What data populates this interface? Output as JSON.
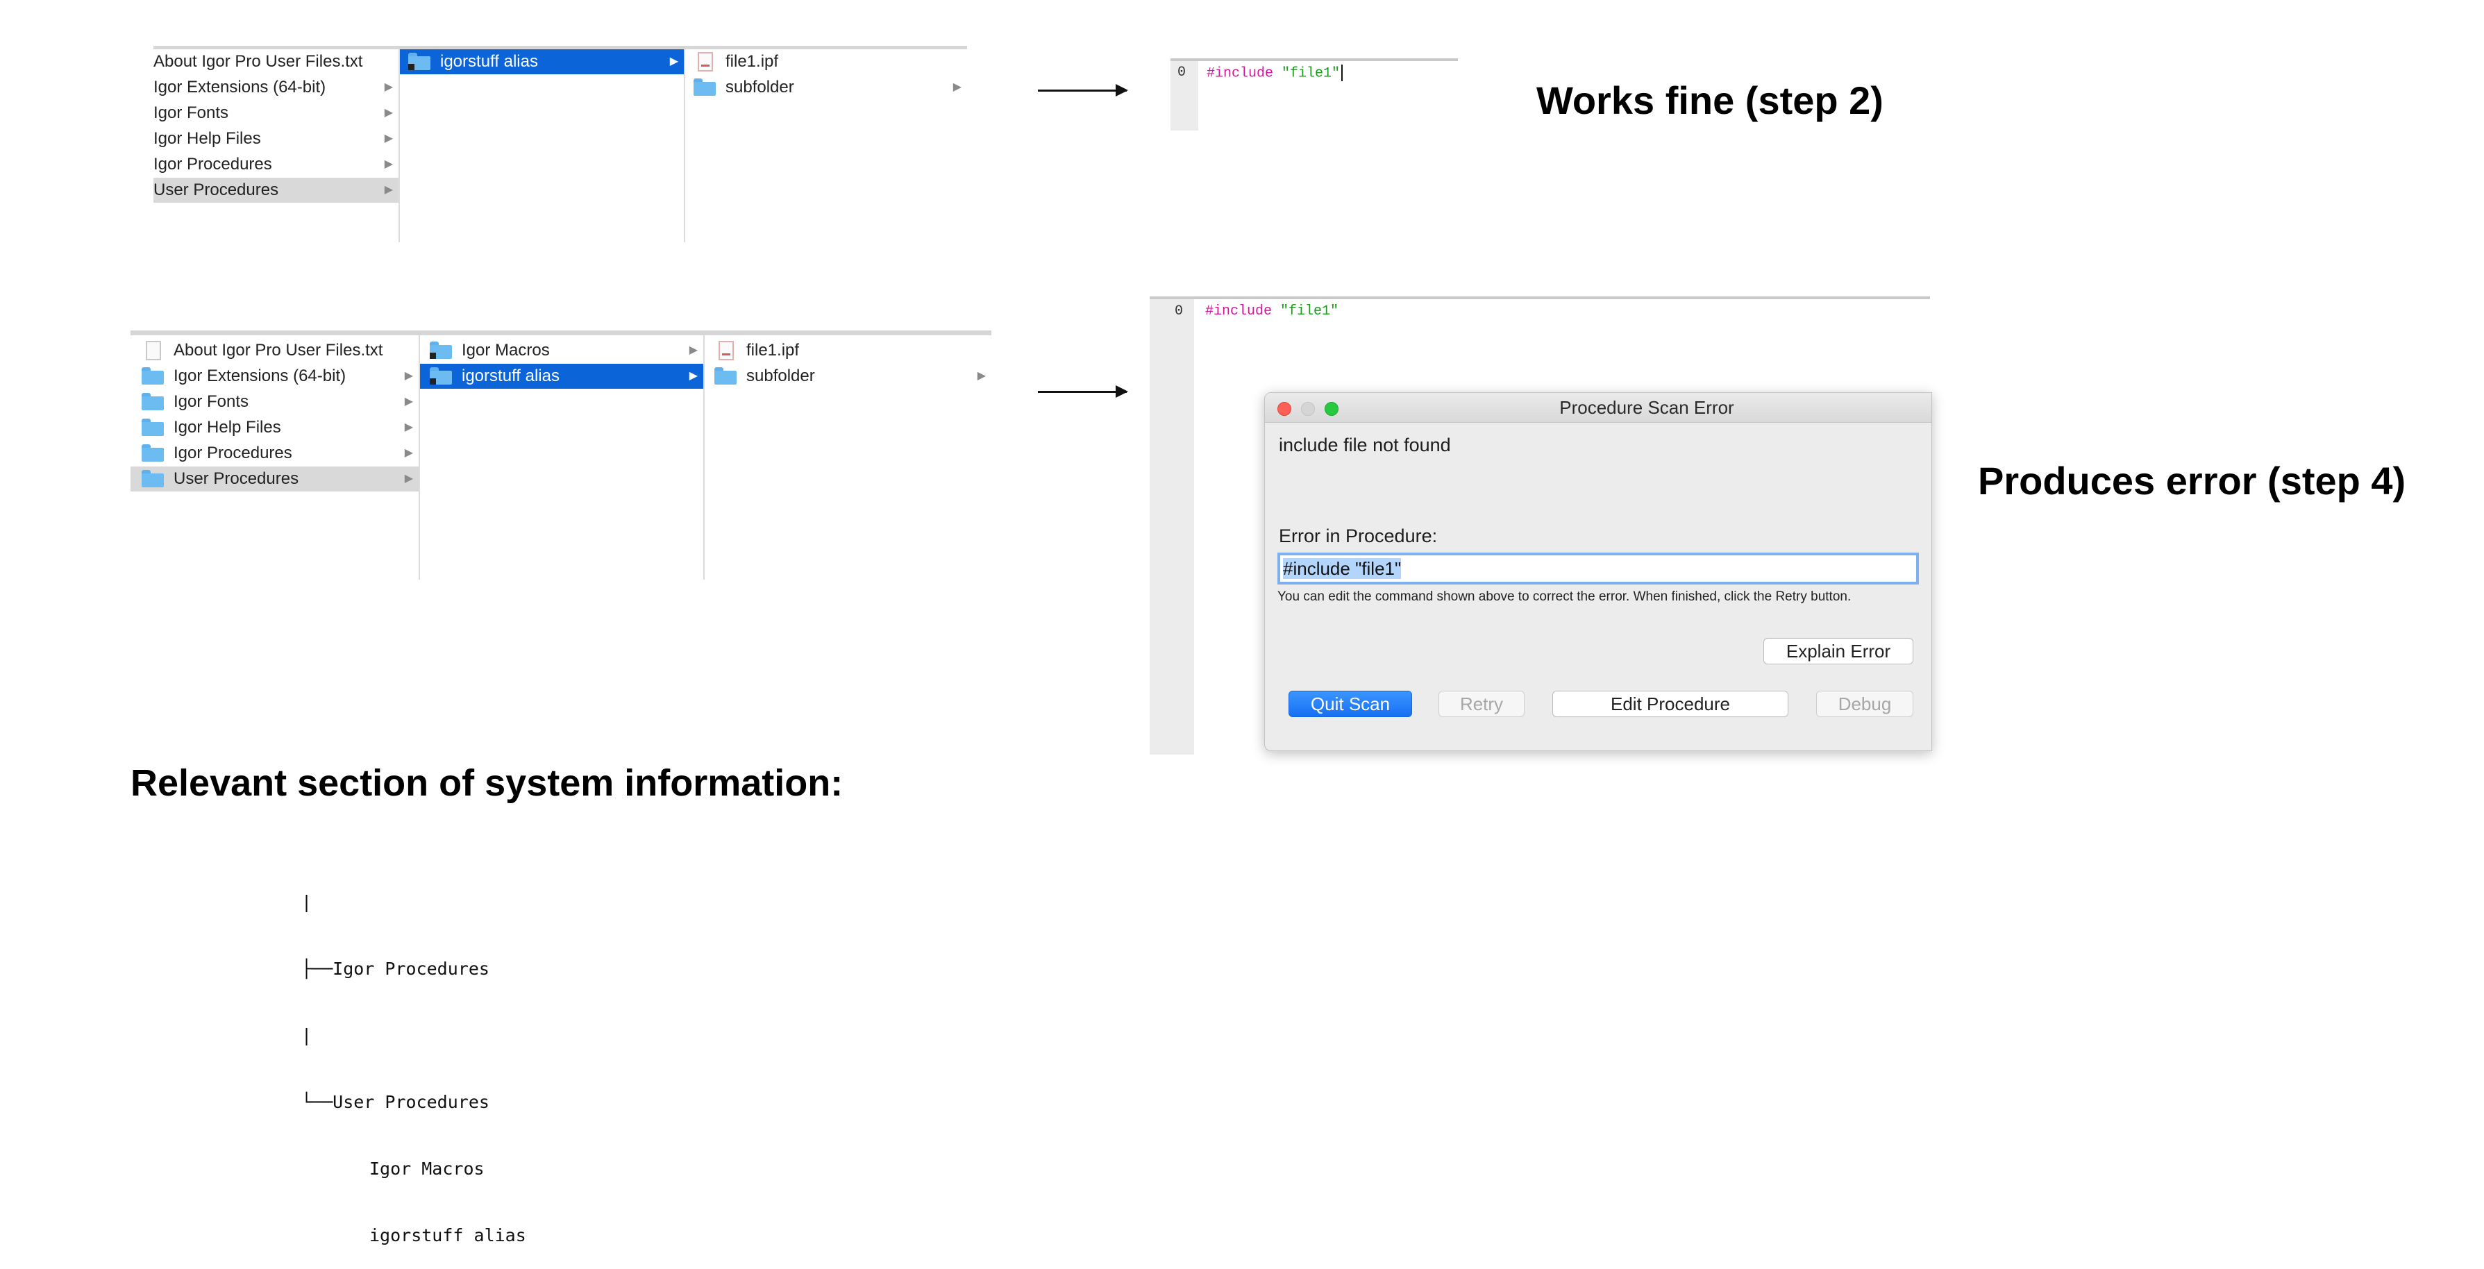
{
  "top_browser": {
    "col1": [
      {
        "label": "About Igor Pro User Files.txt",
        "icon": "none",
        "arrow": false
      },
      {
        "label": "Igor Extensions (64-bit)",
        "icon": "none",
        "arrow": true
      },
      {
        "label": "Igor Fonts",
        "icon": "none",
        "arrow": true
      },
      {
        "label": "Igor Help Files",
        "icon": "none",
        "arrow": true
      },
      {
        "label": "Igor Procedures",
        "icon": "none",
        "arrow": true
      },
      {
        "label": "User Procedures",
        "icon": "none",
        "arrow": true
      }
    ],
    "col2": [
      {
        "label": "igorstuff alias",
        "icon": "folder-alias",
        "arrow": true
      }
    ],
    "col3": [
      {
        "label": "file1.ipf",
        "icon": "ipf-file",
        "arrow": false
      },
      {
        "label": "subfolder",
        "icon": "folder",
        "arrow": true
      }
    ]
  },
  "bottom_browser": {
    "col1": [
      {
        "label": "About Igor Pro User Files.txt",
        "icon": "txt-file",
        "arrow": false
      },
      {
        "label": "Igor Extensions (64-bit)",
        "icon": "folder",
        "arrow": true
      },
      {
        "label": "Igor Fonts",
        "icon": "folder",
        "arrow": true
      },
      {
        "label": "Igor Help Files",
        "icon": "folder",
        "arrow": true
      },
      {
        "label": "Igor Procedures",
        "icon": "folder",
        "arrow": true
      },
      {
        "label": "User Procedures",
        "icon": "folder",
        "arrow": true
      }
    ],
    "col2": [
      {
        "label": "Igor Macros",
        "icon": "folder-alias",
        "arrow": true
      },
      {
        "label": "igorstuff alias",
        "icon": "folder-alias",
        "arrow": true
      }
    ],
    "col3": [
      {
        "label": "file1.ipf",
        "icon": "ipf-file",
        "arrow": false
      },
      {
        "label": "subfolder",
        "icon": "folder",
        "arrow": true
      }
    ]
  },
  "editor_top": {
    "line_number": "0",
    "keyword": "#include",
    "string": "\"file1\""
  },
  "editor_bottom": {
    "line_number": "0",
    "keyword": "#include",
    "string": "\"file1\""
  },
  "labels": {
    "works_fine": "Works fine (step 2)",
    "produces_error": "Produces error (step 4)",
    "system_info": "Relevant section of system information:"
  },
  "dialog": {
    "title": "Procedure Scan Error",
    "message": "include file not found",
    "error_in_label": "Error in Procedure:",
    "command": "#include \"file1\"",
    "hint": "You can edit the command shown above to correct the error. When finished, click the Retry button.",
    "explain_button": "Explain Error",
    "quit_button": "Quit Scan",
    "retry_button": "Retry",
    "edit_button": "Edit Procedure",
    "debug_button": "Debug"
  },
  "tree": {
    "line0": "|",
    "line1": "├──Igor Procedures",
    "line2": "|",
    "line3": "└──User Procedures",
    "line4": "Igor Macros",
    "line5": "igorstuff alias"
  },
  "colors": {
    "selection_blue": "#0b64d8",
    "highlight_gray": "#d9d9d9",
    "keyword_magenta": "#d1179c",
    "string_green": "#1c9a1c",
    "primary_button": "#1670f4"
  }
}
